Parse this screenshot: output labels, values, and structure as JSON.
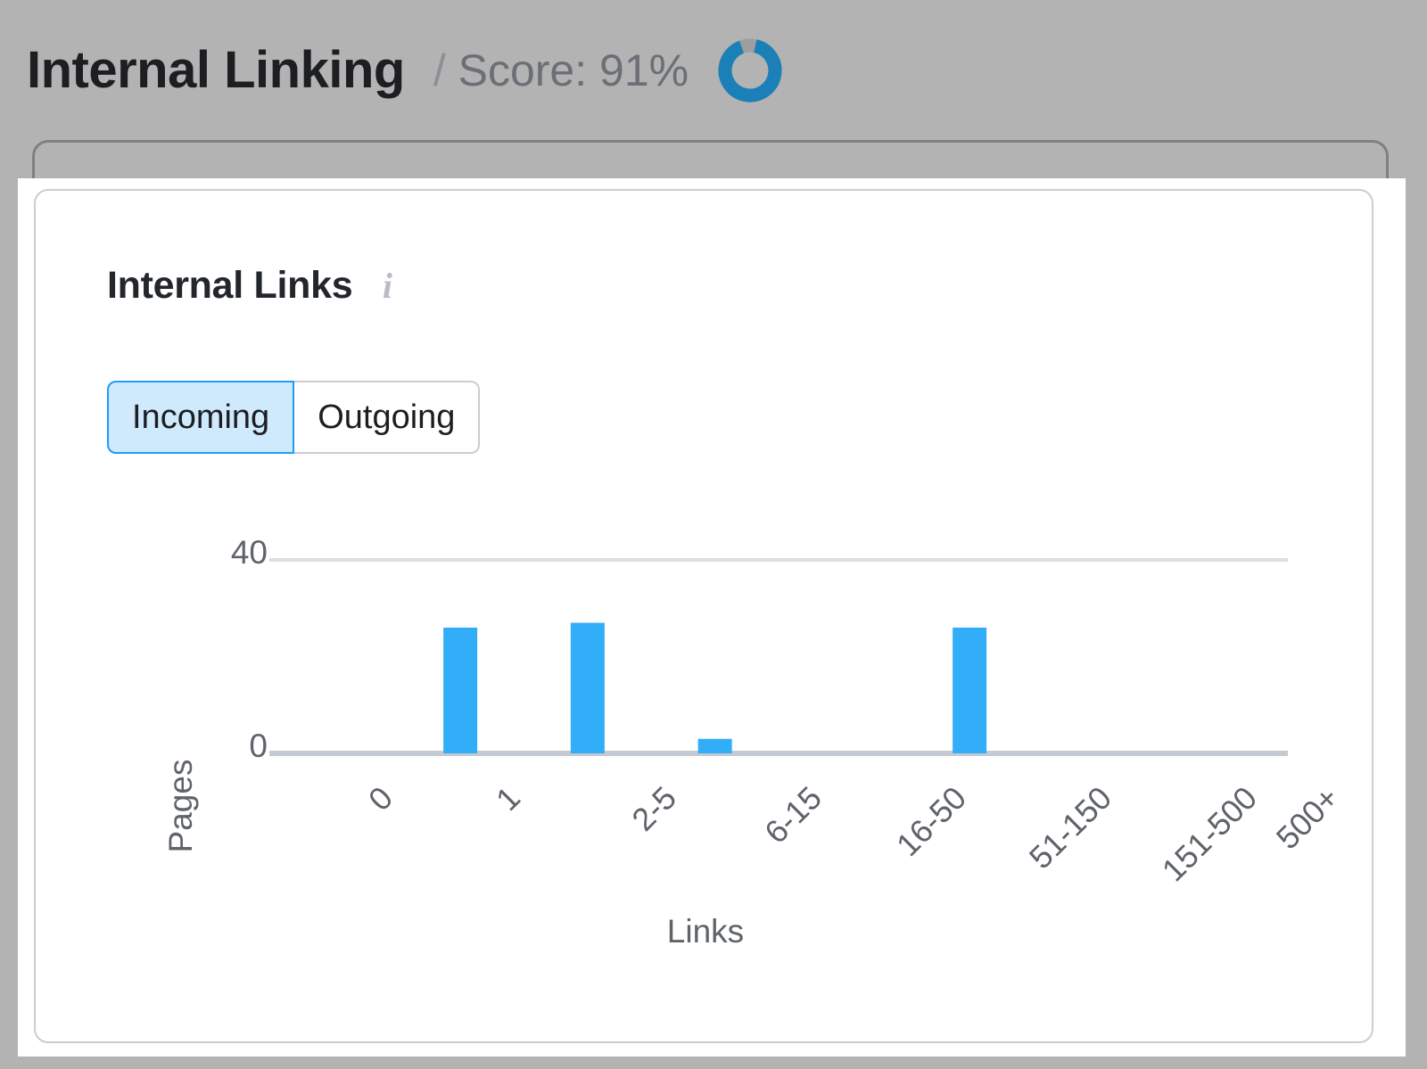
{
  "header": {
    "title": "Internal Linking",
    "separator": "/",
    "score_label": "Score: 91%",
    "score_value": 91,
    "donut": {
      "filled_percent": 91,
      "fill_color": "#1b7fb8",
      "track_color": "#9e9e9e"
    }
  },
  "card": {
    "title": "Internal Links",
    "info_icon": "info-icon",
    "toggle": {
      "options": [
        {
          "label": "Incoming",
          "active": true
        },
        {
          "label": "Outgoing",
          "active": false
        }
      ],
      "active_bg": "#cfe9fd",
      "active_border": "#1f9df5"
    }
  },
  "chart_data": {
    "type": "bar",
    "title": "Internal Links",
    "xlabel": "Links",
    "ylabel": "Pages",
    "categories": [
      "0",
      "1",
      "2-5",
      "6-15",
      "16-50",
      "51-150",
      "151-500",
      "500+"
    ],
    "values": [
      0,
      26,
      27,
      3,
      0,
      26,
      0,
      0
    ],
    "ylim": [
      0,
      40
    ],
    "yticks": [
      0,
      40
    ],
    "ytick_labels": [
      "0",
      "40"
    ],
    "grid": true,
    "legend": false,
    "bar_color": "#32aef8",
    "axis_color": "#c9cdd4",
    "tick_label_rotation": -45
  }
}
